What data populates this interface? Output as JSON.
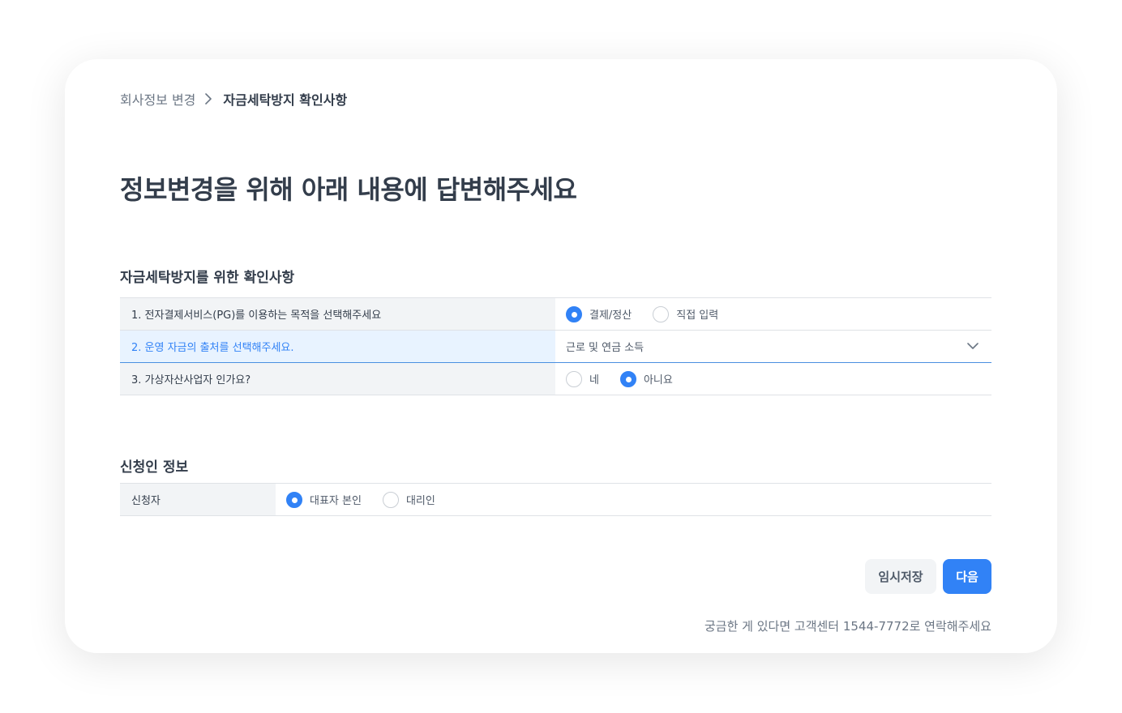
{
  "breadcrumb": {
    "parent": "회사정보 변경",
    "current": "자금세탁방지 확인사항"
  },
  "page_title": "정보변경을 위해 아래 내용에 답변해주세요",
  "aml_section": {
    "title": "자금세탁방지를 위한 확인사항",
    "q1": {
      "label": "1. 전자결제서비스(PG)를 이용하는 목적을 선택해주세요",
      "options": [
        "결제/정산",
        "직접 입력"
      ],
      "selected": "결제/정산"
    },
    "q2": {
      "label": "2. 운영 자금의 출처를 선택해주세요.",
      "selected_value": "근로 및 연금 소득"
    },
    "q3": {
      "label": "3. 가상자산사업자 인가요?",
      "options": [
        "네",
        "아니요"
      ],
      "selected": "아니요"
    }
  },
  "applicant_section": {
    "title": "신청인 정보",
    "applicant": {
      "label": "신청자",
      "options": [
        "대표자 본인",
        "대리인"
      ],
      "selected": "대표자 본인"
    }
  },
  "actions": {
    "temp_save_label": "임시저장",
    "next_label": "다음"
  },
  "help_text": "궁금한 게 있다면 고객센터 1544-7772로 연락해주세요",
  "colors": {
    "accent": "#3182f6",
    "active_row_bg": "#e8f3ff",
    "label_bg": "#f2f4f6",
    "text_primary": "#333d4b",
    "text_secondary": "#6b7684"
  }
}
